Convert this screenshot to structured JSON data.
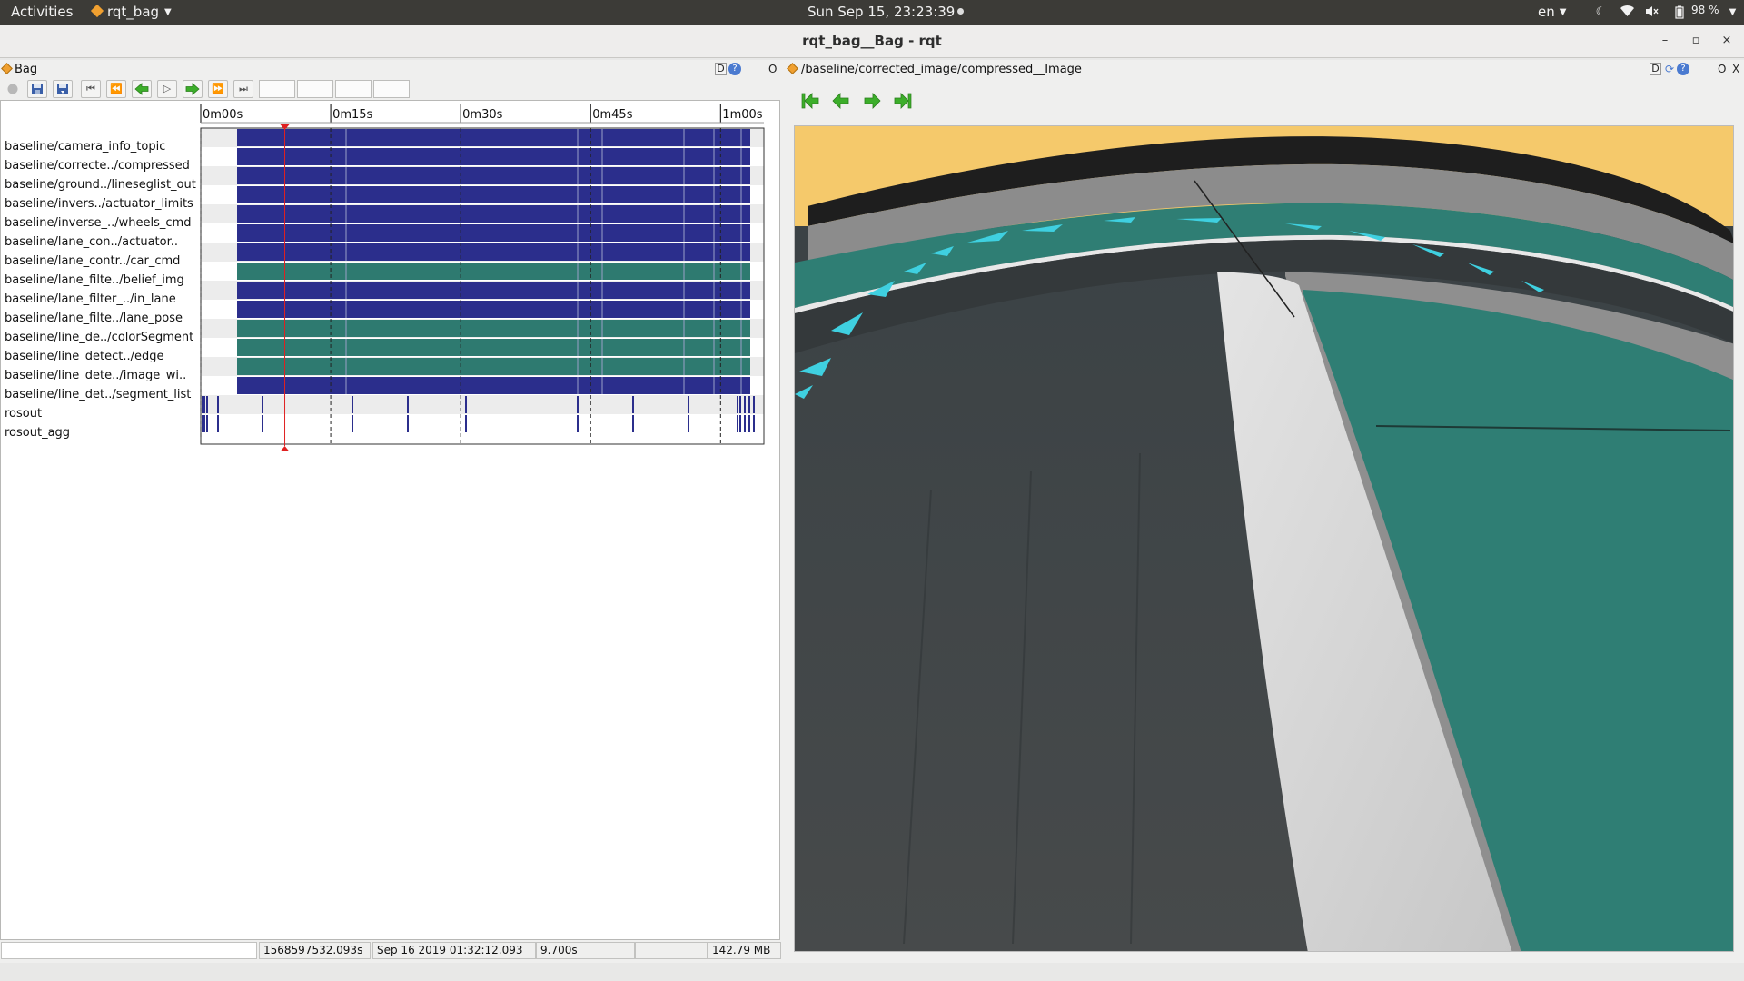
{
  "topbar": {
    "activities": "Activities",
    "app_name": "rqt_bag",
    "clock": "Sun Sep 15, 23:23:39",
    "language": "en",
    "battery": "98 %"
  },
  "window": {
    "title": "rqt_bag__Bag - rqt"
  },
  "bag_panel": {
    "title": "Bag",
    "d_button": "D",
    "help_button": "?",
    "o_button": "O",
    "time_ticks": [
      "0m00s",
      "0m15s",
      "0m30s",
      "0m45s",
      "1m00s"
    ],
    "topics": [
      {
        "name": "baseline/camera_info_topic",
        "color": "#2b2e8c"
      },
      {
        "name": "baseline/correcte../compressed",
        "color": "#2b2e8c"
      },
      {
        "name": "baseline/ground../lineseglist_out",
        "color": "#2b2e8c"
      },
      {
        "name": "baseline/invers../actuator_limits",
        "color": "#2b2e8c"
      },
      {
        "name": "baseline/inverse_../wheels_cmd",
        "color": "#2b2e8c"
      },
      {
        "name": "baseline/lane_con../actuator..",
        "color": "#2b2e8c"
      },
      {
        "name": "baseline/lane_contr../car_cmd",
        "color": "#2b2e8c"
      },
      {
        "name": "baseline/lane_filte../belief_img",
        "color": "#2e7a70"
      },
      {
        "name": "baseline/lane_filter_../in_lane",
        "color": "#2b2e8c"
      },
      {
        "name": "baseline/lane_filte../lane_pose",
        "color": "#2b2e8c"
      },
      {
        "name": "baseline/line_de../colorSegment",
        "color": "#2e7a70"
      },
      {
        "name": "baseline/line_detect../edge",
        "color": "#2e7a70"
      },
      {
        "name": "baseline/line_dete../image_wi..",
        "color": "#2e7a70"
      },
      {
        "name": "baseline/line_det../segment_list",
        "color": "#2b2e8c"
      },
      {
        "name": "rosout",
        "color": "#2b2e8c"
      },
      {
        "name": "rosout_agg",
        "color": "#2b2e8c"
      }
    ],
    "status": {
      "input": "",
      "timestamp": "1568597532.093s",
      "datetime": "Sep 16 2019 01:32:12.093",
      "elapsed": "9.700s",
      "rate": "",
      "size": "142.79 MB"
    },
    "playhead_seconds": 9.7,
    "bag_duration_seconds": 65.0,
    "colors": {
      "topic_blue": "#2b2e8c",
      "topic_teal": "#2e7a70",
      "playhead": "#e02020"
    }
  },
  "image_panel": {
    "title": "/baseline/corrected_image/compressed__Image",
    "d_button": "D",
    "help_button": "?",
    "o_button": "O",
    "x_button": "X",
    "nav_icons": [
      "skip-to-start-icon",
      "step-back-icon",
      "step-forward-icon",
      "skip-to-end-icon"
    ]
  }
}
